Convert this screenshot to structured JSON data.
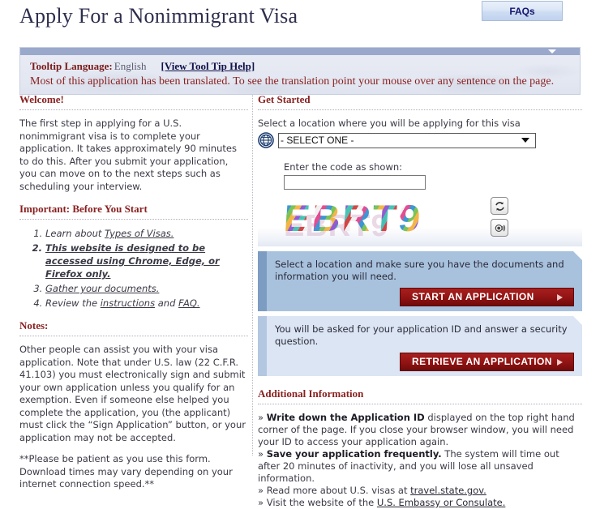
{
  "header": {
    "title": "Apply For a Nonimmigrant Visa",
    "faqs_label": "FAQs"
  },
  "tooltip_banner": {
    "label": "Tooltip Language:",
    "language": "English",
    "help_link": "[View Tool Tip Help]",
    "message": "Most of this application has been translated. To see the translation point your mouse over any sentence on the page.",
    "collapse_icon": "chevron-down-icon",
    "bar_color": "#9aa8cc",
    "message_color": "#8a1f1f"
  },
  "left_column": {
    "welcome_heading": "Welcome!",
    "welcome_text": "The first step in applying for a U.S. nonimmigrant visa is to complete your application. It takes approximately 90 minutes to do this. After you submit your application, you can move on to the next steps such as scheduling your interview.",
    "important_heading": "Important: Before You Start",
    "steps": [
      {
        "prefix": "Learn about ",
        "link": "Types of Visas.",
        "suffix": "",
        "strong": false
      },
      {
        "prefix": "",
        "link": "This website is designed to be accessed using Chrome, Edge, or Firefox only.",
        "suffix": "",
        "strong": true
      },
      {
        "prefix": "",
        "link": "Gather your documents.",
        "suffix": "",
        "strong": false
      },
      {
        "prefix": "Review the ",
        "link": "instructions",
        "middle": " and ",
        "link2": "FAQ.",
        "suffix": "",
        "strong": false
      }
    ],
    "notes_heading": "Notes:",
    "notes_paragraph_1": "Other people can assist you with your visa application. Note that under U.S. law (22 C.F.R. 41.103) you must electronically sign and submit your own application unless you qualify for an exemption. Even if someone else helped you complete the application, you (the applicant) must click the “Sign Application” button, or your application may not be accepted.",
    "notes_paragraph_2": "**Please be patient as you use this form. Download times may vary depending on your internet connection speed.**"
  },
  "right_column": {
    "get_started_heading": "Get Started",
    "select_label": "Select a location where you will be applying for this visa",
    "globe_icon": "globe-icon",
    "location_select": {
      "selected": "- SELECT ONE -",
      "options": [
        "- SELECT ONE -"
      ]
    },
    "code_label": "Enter the code as shown:",
    "code_input_value": "",
    "captcha": {
      "text": "EBRT9",
      "ghost_text": "EBRT9",
      "refresh_icon": "refresh-icon",
      "audio_icon": "speaker-icon"
    },
    "panels": [
      {
        "text": "Select a location and make sure you have the documents and information you will need.",
        "button_label": "START AN APPLICATION",
        "button_color": "#8a1111"
      },
      {
        "text": "You will be asked for your application ID and answer a security question.",
        "button_label": "RETRIEVE AN APPLICATION",
        "button_color": "#8a1111"
      }
    ],
    "additional_heading": "Additional Information",
    "additional_lines": [
      {
        "bullet": "»",
        "bold": "Write down the Application ID",
        "rest": " displayed on the top right hand corner of the page. If you close your browser window, you will need your ID to access your application again."
      },
      {
        "bullet": "»",
        "bold": "Save your application frequently.",
        "rest": " The system will time out after 20 minutes of inactivity, and you will lose all unsaved information."
      },
      {
        "bullet": "»",
        "bold": "",
        "rest": "Read more about U.S. visas at ",
        "link": "travel.state.gov."
      },
      {
        "bullet": "»",
        "bold": "",
        "rest": "Visit the website of the ",
        "link": "U.S. Embassy or Consulate."
      }
    ]
  }
}
